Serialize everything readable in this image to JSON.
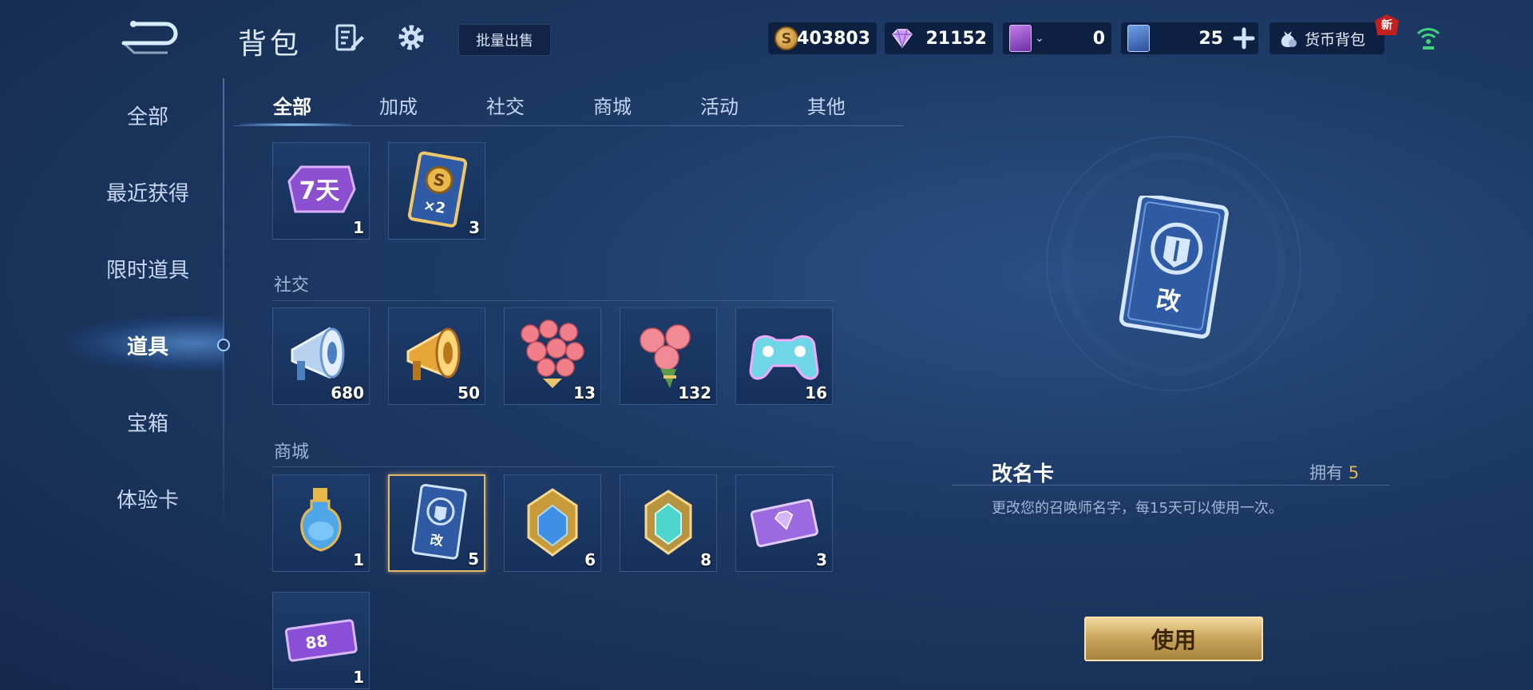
{
  "header": {
    "title": "背包",
    "batch_sell": "批量出售",
    "currencies": [
      {
        "icon": "gold-coin-icon",
        "value": "403803"
      },
      {
        "icon": "diamond-icon",
        "value": "21152"
      },
      {
        "icon": "purple-card-icon",
        "value": "0"
      },
      {
        "icon": "blue-card-icon",
        "value": "25"
      }
    ],
    "wallet_label": "货币背包",
    "new_badge": "新"
  },
  "sidebar": {
    "items": [
      {
        "label": "全部"
      },
      {
        "label": "最近获得"
      },
      {
        "label": "限时道具"
      },
      {
        "label": "道具",
        "active": true
      },
      {
        "label": "宝箱"
      },
      {
        "label": "体验卡"
      }
    ]
  },
  "tabs": [
    {
      "label": "全部",
      "active": true
    },
    {
      "label": "加成"
    },
    {
      "label": "社交"
    },
    {
      "label": "商城"
    },
    {
      "label": "活动"
    },
    {
      "label": "其他"
    }
  ],
  "sections": {
    "boost": {
      "items": [
        {
          "name": "seven-day-card-icon",
          "count": "1",
          "icon_text": "7天"
        },
        {
          "name": "gold-double-card-icon",
          "count": "3",
          "icon_text": "×2"
        }
      ]
    },
    "social": {
      "label": "社交",
      "items": [
        {
          "name": "silver-horn-icon",
          "count": "680"
        },
        {
          "name": "gold-horn-icon",
          "count": "50"
        },
        {
          "name": "rose-bouquet-icon",
          "count": "13"
        },
        {
          "name": "rose-bunch-icon",
          "count": "132"
        },
        {
          "name": "gamepad-icon",
          "count": "16"
        }
      ]
    },
    "shop": {
      "label": "商城",
      "items": [
        {
          "name": "potion-bottle-icon",
          "count": "1"
        },
        {
          "name": "rename-card-icon",
          "count": "5",
          "selected": true
        },
        {
          "name": "blue-crystal-icon",
          "count": "6"
        },
        {
          "name": "cyan-crystal-icon",
          "count": "8"
        },
        {
          "name": "purple-gem-ticket-icon",
          "count": "3"
        },
        {
          "name": "ticket-88-icon",
          "count": "1",
          "icon_text": "88"
        }
      ]
    }
  },
  "detail": {
    "name": "改名卡",
    "own_label": "拥有",
    "own_count": "5",
    "description": "更改您的召唤师名字，每15天可以使用一次。",
    "card_char": "改",
    "use_button": "使用"
  },
  "colors": {
    "gold": "#e2b550",
    "accent_blue": "#9fd7ff",
    "bg": "#1d3a66"
  }
}
